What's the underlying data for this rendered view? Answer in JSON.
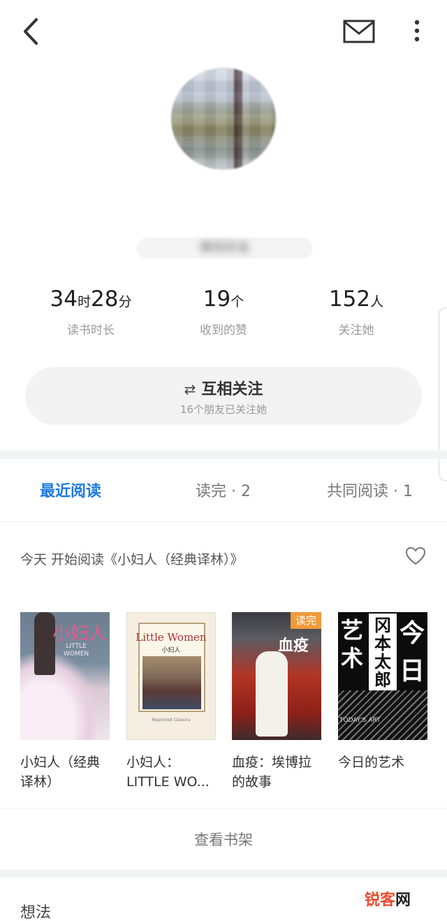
{
  "header": {
    "back_icon": "back-arrow-icon",
    "mail_icon": "mail-icon",
    "more_icon": "more-vertical-icon"
  },
  "profile": {
    "username": "",
    "friend_source": "微信好友"
  },
  "stats": [
    {
      "num1": "34",
      "unit1": "时",
      "num2": "28",
      "unit2": "分",
      "label": "读书时长"
    },
    {
      "num1": "19",
      "unit1": "个",
      "label": "收到的赞"
    },
    {
      "num1": "152",
      "unit1": "人",
      "label": "关注她"
    }
  ],
  "follow": {
    "icon": "⇄",
    "label": "互相关注",
    "sub": "16个朋友已关注她"
  },
  "tabs": [
    {
      "label": "最近阅读",
      "active": true
    },
    {
      "label": "读完 · 2",
      "active": false
    },
    {
      "label": "共同阅读 · 1",
      "active": false
    }
  ],
  "activity": {
    "text": "今天 开始阅读《小妇人（经典译林）》",
    "like_icon": "heart-outline-icon"
  },
  "books": [
    {
      "title": "小妇人（经典\n译林）",
      "cover_title": "小妇人",
      "cover_sub": "LITTLE\nWOMEN"
    },
    {
      "title": "小妇人：\nLITTLE WO...",
      "cover_title": "Little Women",
      "cover_sub": "小妇人",
      "cover_foot": "Reprinted Classics"
    },
    {
      "title": "血疫：埃博拉\n的故事",
      "cover_title": "血疫",
      "badge": "读完"
    },
    {
      "title": "今日的艺术",
      "cover_c1": "艺术",
      "cover_c2": "冈本太郎",
      "cover_c3": "今日的",
      "cover_sub": "TODAY'S ART"
    }
  ],
  "bookshelf_link": "查看书架",
  "ideas_title": "想法",
  "watermark": {
    "part1": "锐客",
    "part2": "网"
  },
  "colors": {
    "accent": "#1e7be0",
    "badge": "#f09a3b",
    "separator": "#f2f3f5"
  }
}
